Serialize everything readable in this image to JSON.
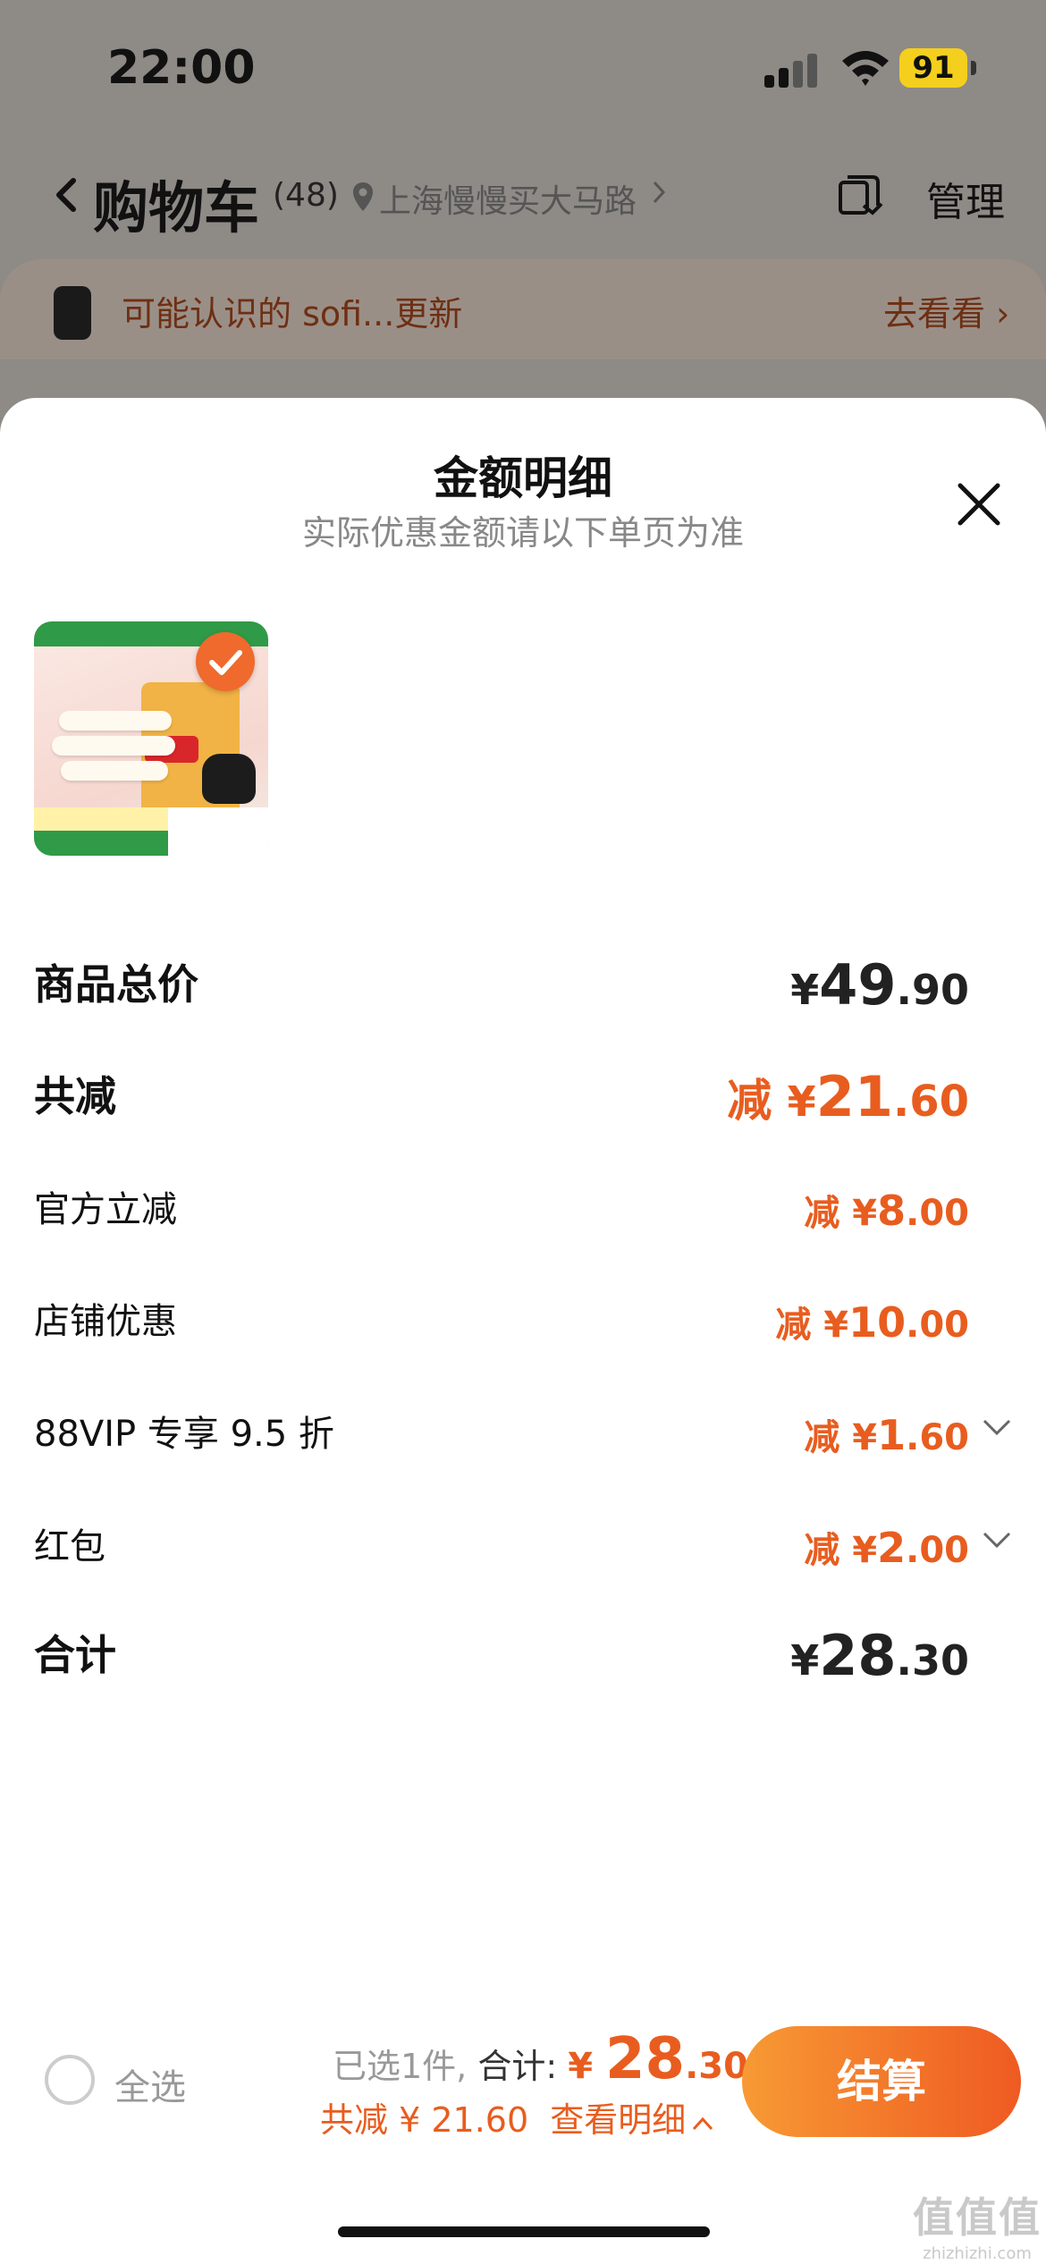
{
  "status_bar": {
    "time": "22:00",
    "battery": "91"
  },
  "nav": {
    "title": "购物车",
    "count": "(48)",
    "address": "上海慢慢买大马路",
    "manage": "管理"
  },
  "notice": {
    "text": "可能认识的 sofi...更新",
    "link": "去看看 ›"
  },
  "sheet": {
    "title": "金额明细",
    "subtitle": "实际优惠金额请以下单页为准",
    "rows": [
      {
        "label": "商品总价",
        "prefix": "",
        "symbol": "¥",
        "int": "49",
        "dec": ".90"
      },
      {
        "label": "共减",
        "prefix": "减 ",
        "symbol": "¥",
        "int": "21",
        "dec": ".60"
      },
      {
        "label": "官方立减",
        "prefix": "减 ",
        "symbol": "¥",
        "int": "8",
        "dec": ".00"
      },
      {
        "label": "店铺优惠",
        "prefix": "减 ",
        "symbol": "¥",
        "int": "10",
        "dec": ".00"
      },
      {
        "label": "88VIP 专享 9.5 折",
        "prefix": "减 ",
        "symbol": "¥",
        "int": "1",
        "dec": ".60"
      },
      {
        "label": "红包",
        "prefix": "减 ",
        "symbol": "¥",
        "int": "2",
        "dec": ".00"
      },
      {
        "label": "合计",
        "prefix": "",
        "symbol": "¥",
        "int": "28",
        "dec": ".30"
      }
    ]
  },
  "bottom_bar": {
    "select_all": "全选",
    "selected_prefix": "已选1件,",
    "total_label": " 合计: ",
    "total_symbol": "¥ ",
    "total_int": "28",
    "total_dec": ".30",
    "discount_text": "共减 ¥ 21.60",
    "detail_link": "查看明细",
    "checkout": "结算"
  },
  "watermark": {
    "mark": "值值值",
    "url": "zhizhizhi.com"
  },
  "colors": {
    "accent": "#e85d1f",
    "checkout_start": "#f79a34",
    "checkout_end": "#ef5a22"
  }
}
